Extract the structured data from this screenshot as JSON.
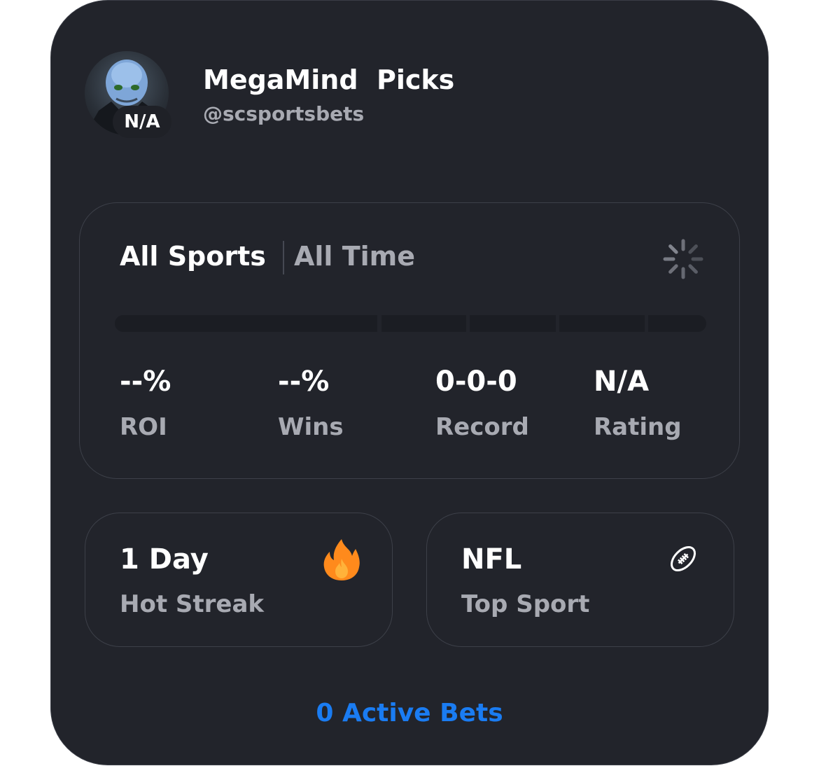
{
  "profile": {
    "name": "MegaMind  Picks",
    "handle": "@scsportsbets",
    "badge": "N/A"
  },
  "filters": {
    "sport": "All Sports",
    "period": "All Time",
    "loading_icon": "spinner-icon"
  },
  "stats": [
    {
      "value": "--%",
      "label": "ROI"
    },
    {
      "value": "--%",
      "label": "Wins"
    },
    {
      "value": "0-0-0",
      "label": "Record"
    },
    {
      "value": "N/A",
      "label": "Rating"
    }
  ],
  "highlights": {
    "streak": {
      "value": "1 Day",
      "label": "Hot Streak",
      "icon": "fire-icon"
    },
    "top_sport": {
      "value": "NFL",
      "label": "Top Sport",
      "icon": "football-icon"
    }
  },
  "footer": {
    "active_bets": "0 Active Bets"
  },
  "colors": {
    "card_bg": "#22242b",
    "accent": "#1a7cf2",
    "fire": "#ff8a1c"
  }
}
